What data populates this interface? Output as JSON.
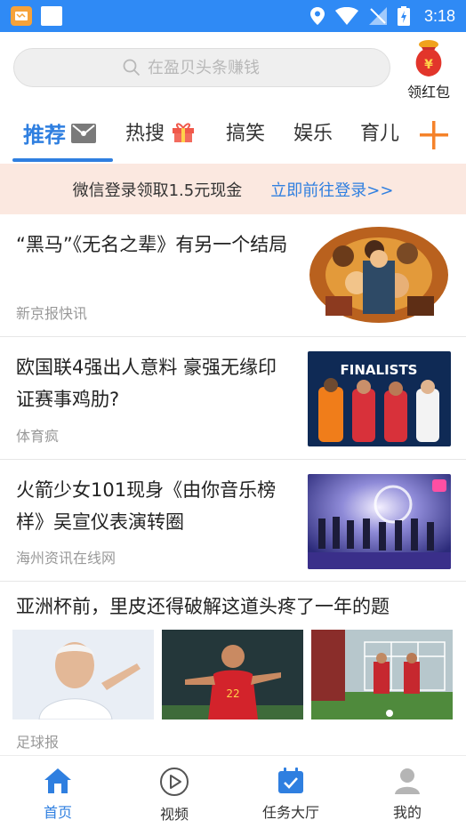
{
  "status_bar": {
    "time": "3:18"
  },
  "search": {
    "placeholder": "在盈贝头条赚钱"
  },
  "redpacket": {
    "label": "领红包"
  },
  "tabs": [
    {
      "label": "推荐",
      "active": true
    },
    {
      "label": "热搜"
    },
    {
      "label": "搞笑"
    },
    {
      "label": "娱乐"
    },
    {
      "label": "育儿"
    }
  ],
  "banner": {
    "text": "微信登录领取1.5元现金",
    "link": "立即前往登录>>"
  },
  "news": [
    {
      "title": "“黑马”《无名之辈》有另一个结局",
      "source": "新京报快讯",
      "thumb": "movie-poster"
    },
    {
      "title": "欧国联4强出人意料 豪强无缘印证赛事鸡肋?",
      "source": "体育疯",
      "thumb": "finalists-photo",
      "thumb_text": "FINALISTS"
    },
    {
      "title": "火箭少女101现身《由你音乐榜样》吴宣仪表演转圈",
      "source": "海州资讯在线网",
      "thumb": "stage-photo"
    },
    {
      "title": "亚洲杯前，里皮还得破解这道头疼了一年的题",
      "source": "足球报",
      "thumbs": [
        "coach-photo",
        "player-photo",
        "team-photo"
      ]
    }
  ],
  "bottom_nav": [
    {
      "label": "首页",
      "icon": "home-icon",
      "active": true
    },
    {
      "label": "视频",
      "icon": "play-icon"
    },
    {
      "label": "任务大厅",
      "icon": "task-icon"
    },
    {
      "label": "我的",
      "icon": "user-icon"
    }
  ],
  "colors": {
    "accent": "#2f7fe0",
    "statusbar": "#2f8af5",
    "banner_bg": "#fbe8e0",
    "plus": "#f5822a"
  }
}
